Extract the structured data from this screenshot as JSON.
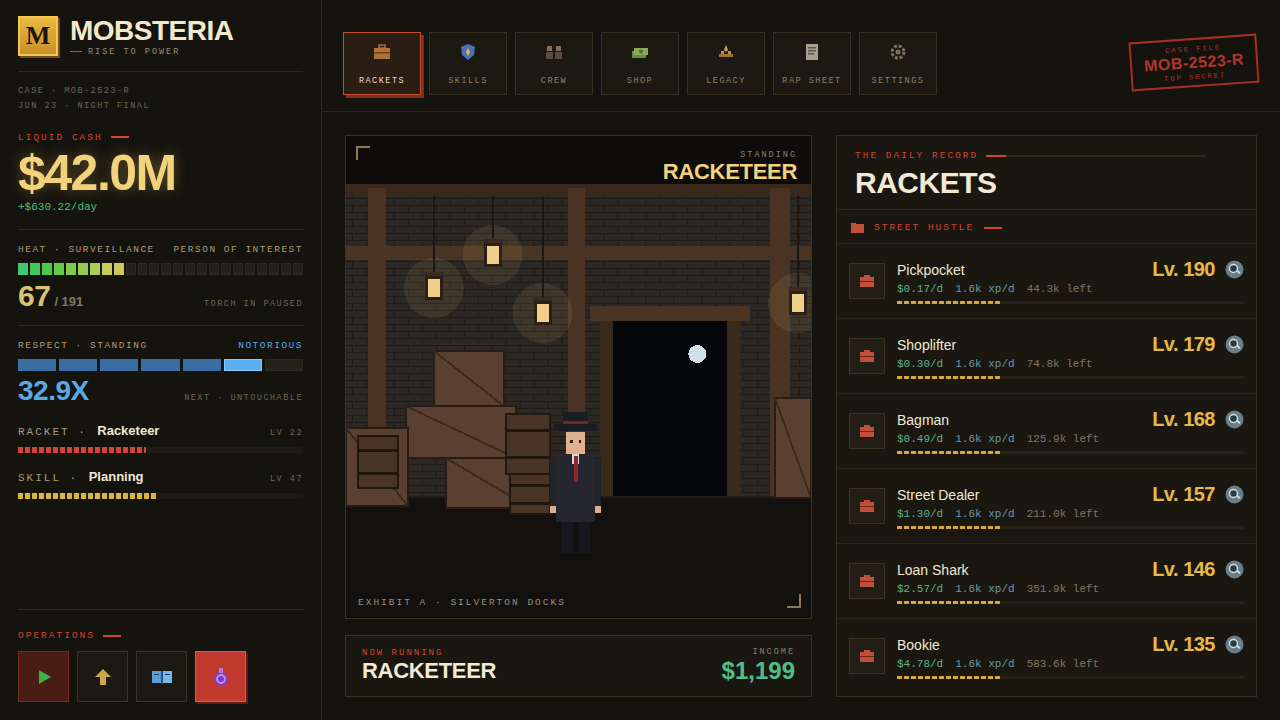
{
  "brand": {
    "letter": "M",
    "title": "MOBSTERIA",
    "subtitle": "RISE TO POWER"
  },
  "case_info": {
    "case": "CASE · MOB-2523-R",
    "date": "JUN 23 · NIGHT FINAL"
  },
  "cash": {
    "label": "LIQUID CASH",
    "value": "$42.0M",
    "rate": "+$630.22/day"
  },
  "heat": {
    "label": "HEAT · SURVEILLANCE",
    "status": "PERSON OF INTEREST",
    "value": "67",
    "max": "/ 191",
    "note": "TORCH IN PAUSED",
    "level": 0.375
  },
  "respect": {
    "label": "RESPECT · STANDING",
    "rank": "NOTORIOUS",
    "value": "32.9X",
    "next": "NEXT · UNTOUCHABLE",
    "level": 0.857
  },
  "progress": [
    {
      "label": "RACKET ·",
      "name": "Racketeer",
      "lv": "LV 22",
      "level": 0.45,
      "color": "#d2443a"
    },
    {
      "label": "SKILL ·",
      "name": "Planning",
      "lv": "LV 47",
      "level": 0.49,
      "color": "#d8b440"
    }
  ],
  "operations": {
    "label": "OPERATIONS",
    "buttons": [
      {
        "kind": "play",
        "on": true,
        "selected": false
      },
      {
        "kind": "upgrade",
        "on": false,
        "selected": false
      },
      {
        "kind": "book",
        "on": false,
        "selected": false
      },
      {
        "kind": "potion",
        "on": false,
        "selected": true
      }
    ]
  },
  "tabs": [
    {
      "label": "RACKETS",
      "kind": "briefcase",
      "selected": true
    },
    {
      "label": "SKILLS",
      "kind": "skills",
      "selected": false
    },
    {
      "label": "CREW",
      "kind": "crew",
      "selected": false
    },
    {
      "label": "SHOP",
      "kind": "shop",
      "selected": false
    },
    {
      "label": "LEGACY",
      "kind": "legacy",
      "selected": false
    },
    {
      "label": "RAP SHEET",
      "kind": "rapsheet",
      "selected": false
    },
    {
      "label": "SETTINGS",
      "kind": "settings",
      "selected": false
    }
  ],
  "stamp": {
    "top": "CASE FILE",
    "main": "MOB-2523-R",
    "bottom": "TOP SECRET"
  },
  "scene": {
    "standing_label": "STANDING",
    "standing": "RACKETEER",
    "caption": "EXHIBIT A · SILVERTON DOCKS"
  },
  "now_running": {
    "label": "NOW RUNNING",
    "name": "RACKETEER",
    "income_label": "INCOME",
    "income": "$1,199"
  },
  "record": {
    "kicker": "THE DAILY RECORD",
    "title": "RACKETS",
    "section": "STREET HUSTLE",
    "rows": [
      {
        "name": "Pickpocket",
        "lv": "Lv. 190",
        "rate": "$0.17/d",
        "xp": "1.6k xp/d",
        "left": "44.3k left",
        "level": 0.3
      },
      {
        "name": "Shoplifter",
        "lv": "Lv. 179",
        "rate": "$0.30/d",
        "xp": "1.6k xp/d",
        "left": "74.8k left",
        "level": 0.3
      },
      {
        "name": "Bagman",
        "lv": "Lv. 168",
        "rate": "$0.49/d",
        "xp": "1.6k xp/d",
        "left": "125.9k left",
        "level": 0.3
      },
      {
        "name": "Street Dealer",
        "lv": "Lv. 157",
        "rate": "$1.30/d",
        "xp": "1.6k xp/d",
        "left": "211.0k left",
        "level": 0.3
      },
      {
        "name": "Loan Shark",
        "lv": "Lv. 146",
        "rate": "$2.57/d",
        "xp": "1.6k xp/d",
        "left": "351.9k left",
        "level": 0.3
      },
      {
        "name": "Bookie",
        "lv": "Lv. 135",
        "rate": "$4.78/d",
        "xp": "1.6k xp/d",
        "left": "583.6k left",
        "level": 0.3
      }
    ]
  }
}
